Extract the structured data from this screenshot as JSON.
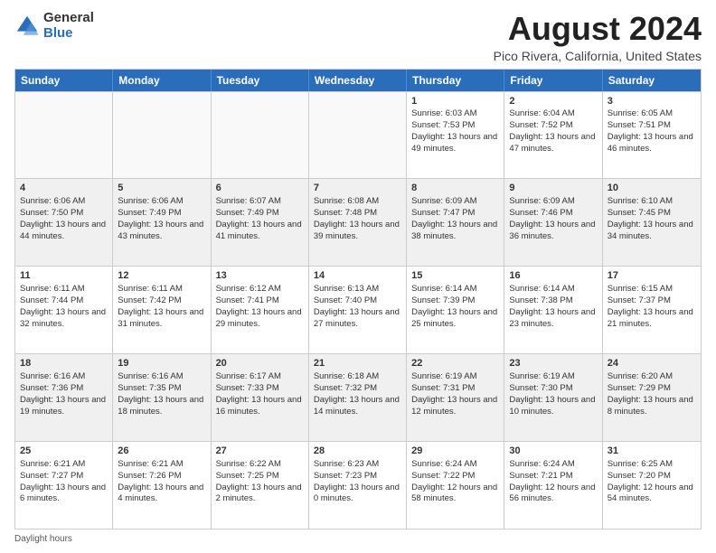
{
  "logo": {
    "general": "General",
    "blue": "Blue"
  },
  "title": "August 2024",
  "subtitle": "Pico Rivera, California, United States",
  "header_days": [
    "Sunday",
    "Monday",
    "Tuesday",
    "Wednesday",
    "Thursday",
    "Friday",
    "Saturday"
  ],
  "weeks": [
    [
      {
        "day": "",
        "info": ""
      },
      {
        "day": "",
        "info": ""
      },
      {
        "day": "",
        "info": ""
      },
      {
        "day": "",
        "info": ""
      },
      {
        "day": "1",
        "info": "Sunrise: 6:03 AM\nSunset: 7:53 PM\nDaylight: 13 hours and 49 minutes."
      },
      {
        "day": "2",
        "info": "Sunrise: 6:04 AM\nSunset: 7:52 PM\nDaylight: 13 hours and 47 minutes."
      },
      {
        "day": "3",
        "info": "Sunrise: 6:05 AM\nSunset: 7:51 PM\nDaylight: 13 hours and 46 minutes."
      }
    ],
    [
      {
        "day": "4",
        "info": "Sunrise: 6:06 AM\nSunset: 7:50 PM\nDaylight: 13 hours and 44 minutes."
      },
      {
        "day": "5",
        "info": "Sunrise: 6:06 AM\nSunset: 7:49 PM\nDaylight: 13 hours and 43 minutes."
      },
      {
        "day": "6",
        "info": "Sunrise: 6:07 AM\nSunset: 7:49 PM\nDaylight: 13 hours and 41 minutes."
      },
      {
        "day": "7",
        "info": "Sunrise: 6:08 AM\nSunset: 7:48 PM\nDaylight: 13 hours and 39 minutes."
      },
      {
        "day": "8",
        "info": "Sunrise: 6:09 AM\nSunset: 7:47 PM\nDaylight: 13 hours and 38 minutes."
      },
      {
        "day": "9",
        "info": "Sunrise: 6:09 AM\nSunset: 7:46 PM\nDaylight: 13 hours and 36 minutes."
      },
      {
        "day": "10",
        "info": "Sunrise: 6:10 AM\nSunset: 7:45 PM\nDaylight: 13 hours and 34 minutes."
      }
    ],
    [
      {
        "day": "11",
        "info": "Sunrise: 6:11 AM\nSunset: 7:44 PM\nDaylight: 13 hours and 32 minutes."
      },
      {
        "day": "12",
        "info": "Sunrise: 6:11 AM\nSunset: 7:42 PM\nDaylight: 13 hours and 31 minutes."
      },
      {
        "day": "13",
        "info": "Sunrise: 6:12 AM\nSunset: 7:41 PM\nDaylight: 13 hours and 29 minutes."
      },
      {
        "day": "14",
        "info": "Sunrise: 6:13 AM\nSunset: 7:40 PM\nDaylight: 13 hours and 27 minutes."
      },
      {
        "day": "15",
        "info": "Sunrise: 6:14 AM\nSunset: 7:39 PM\nDaylight: 13 hours and 25 minutes."
      },
      {
        "day": "16",
        "info": "Sunrise: 6:14 AM\nSunset: 7:38 PM\nDaylight: 13 hours and 23 minutes."
      },
      {
        "day": "17",
        "info": "Sunrise: 6:15 AM\nSunset: 7:37 PM\nDaylight: 13 hours and 21 minutes."
      }
    ],
    [
      {
        "day": "18",
        "info": "Sunrise: 6:16 AM\nSunset: 7:36 PM\nDaylight: 13 hours and 19 minutes."
      },
      {
        "day": "19",
        "info": "Sunrise: 6:16 AM\nSunset: 7:35 PM\nDaylight: 13 hours and 18 minutes."
      },
      {
        "day": "20",
        "info": "Sunrise: 6:17 AM\nSunset: 7:33 PM\nDaylight: 13 hours and 16 minutes."
      },
      {
        "day": "21",
        "info": "Sunrise: 6:18 AM\nSunset: 7:32 PM\nDaylight: 13 hours and 14 minutes."
      },
      {
        "day": "22",
        "info": "Sunrise: 6:19 AM\nSunset: 7:31 PM\nDaylight: 13 hours and 12 minutes."
      },
      {
        "day": "23",
        "info": "Sunrise: 6:19 AM\nSunset: 7:30 PM\nDaylight: 13 hours and 10 minutes."
      },
      {
        "day": "24",
        "info": "Sunrise: 6:20 AM\nSunset: 7:29 PM\nDaylight: 13 hours and 8 minutes."
      }
    ],
    [
      {
        "day": "25",
        "info": "Sunrise: 6:21 AM\nSunset: 7:27 PM\nDaylight: 13 hours and 6 minutes."
      },
      {
        "day": "26",
        "info": "Sunrise: 6:21 AM\nSunset: 7:26 PM\nDaylight: 13 hours and 4 minutes."
      },
      {
        "day": "27",
        "info": "Sunrise: 6:22 AM\nSunset: 7:25 PM\nDaylight: 13 hours and 2 minutes."
      },
      {
        "day": "28",
        "info": "Sunrise: 6:23 AM\nSunset: 7:23 PM\nDaylight: 13 hours and 0 minutes."
      },
      {
        "day": "29",
        "info": "Sunrise: 6:24 AM\nSunset: 7:22 PM\nDaylight: 12 hours and 58 minutes."
      },
      {
        "day": "30",
        "info": "Sunrise: 6:24 AM\nSunset: 7:21 PM\nDaylight: 12 hours and 56 minutes."
      },
      {
        "day": "31",
        "info": "Sunrise: 6:25 AM\nSunset: 7:20 PM\nDaylight: 12 hours and 54 minutes."
      }
    ]
  ],
  "footer": "Daylight hours"
}
